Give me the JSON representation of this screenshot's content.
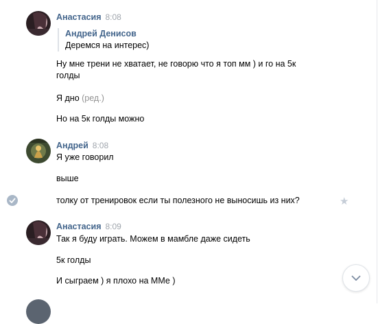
{
  "colors": {
    "author": "#42648b",
    "time": "#a0a6ad",
    "edited": "#939393",
    "check_bg": "#a9b7c7",
    "star": "#c5cdd7"
  },
  "groups": [
    {
      "author": "Анастасия",
      "time": "8:08",
      "forwarded": {
        "author": "Андрей Денисов",
        "text": "Деремся на интерес)"
      },
      "messages": [
        {
          "line1": "Ну мне трени не хватает, не говорю что я топ мм ) и го на 5к",
          "line2": "голды"
        },
        {
          "text": "Я дно",
          "edited": "(ред.)"
        },
        {
          "text": "Но на 5к голды можно"
        }
      ]
    },
    {
      "author": "Андрей",
      "time": "8:08",
      "messages": [
        {
          "text": "Я уже говорил"
        },
        {
          "text": "выше"
        },
        {
          "text": "толку от тренировок если ты полезного не выносишь из них?"
        }
      ]
    },
    {
      "author": "Анастасия",
      "time": "8:09",
      "messages": [
        {
          "text": "Так я буду играть. Можем в мамбле даже сидеть"
        },
        {
          "text": "5к голды"
        },
        {
          "text": "И сыграем ) я плохо на ММе )"
        }
      ]
    }
  ],
  "icons": {
    "selected_check": "check-circle-icon",
    "favorite": "star-icon",
    "scroll_down": "chevron-down-icon"
  }
}
